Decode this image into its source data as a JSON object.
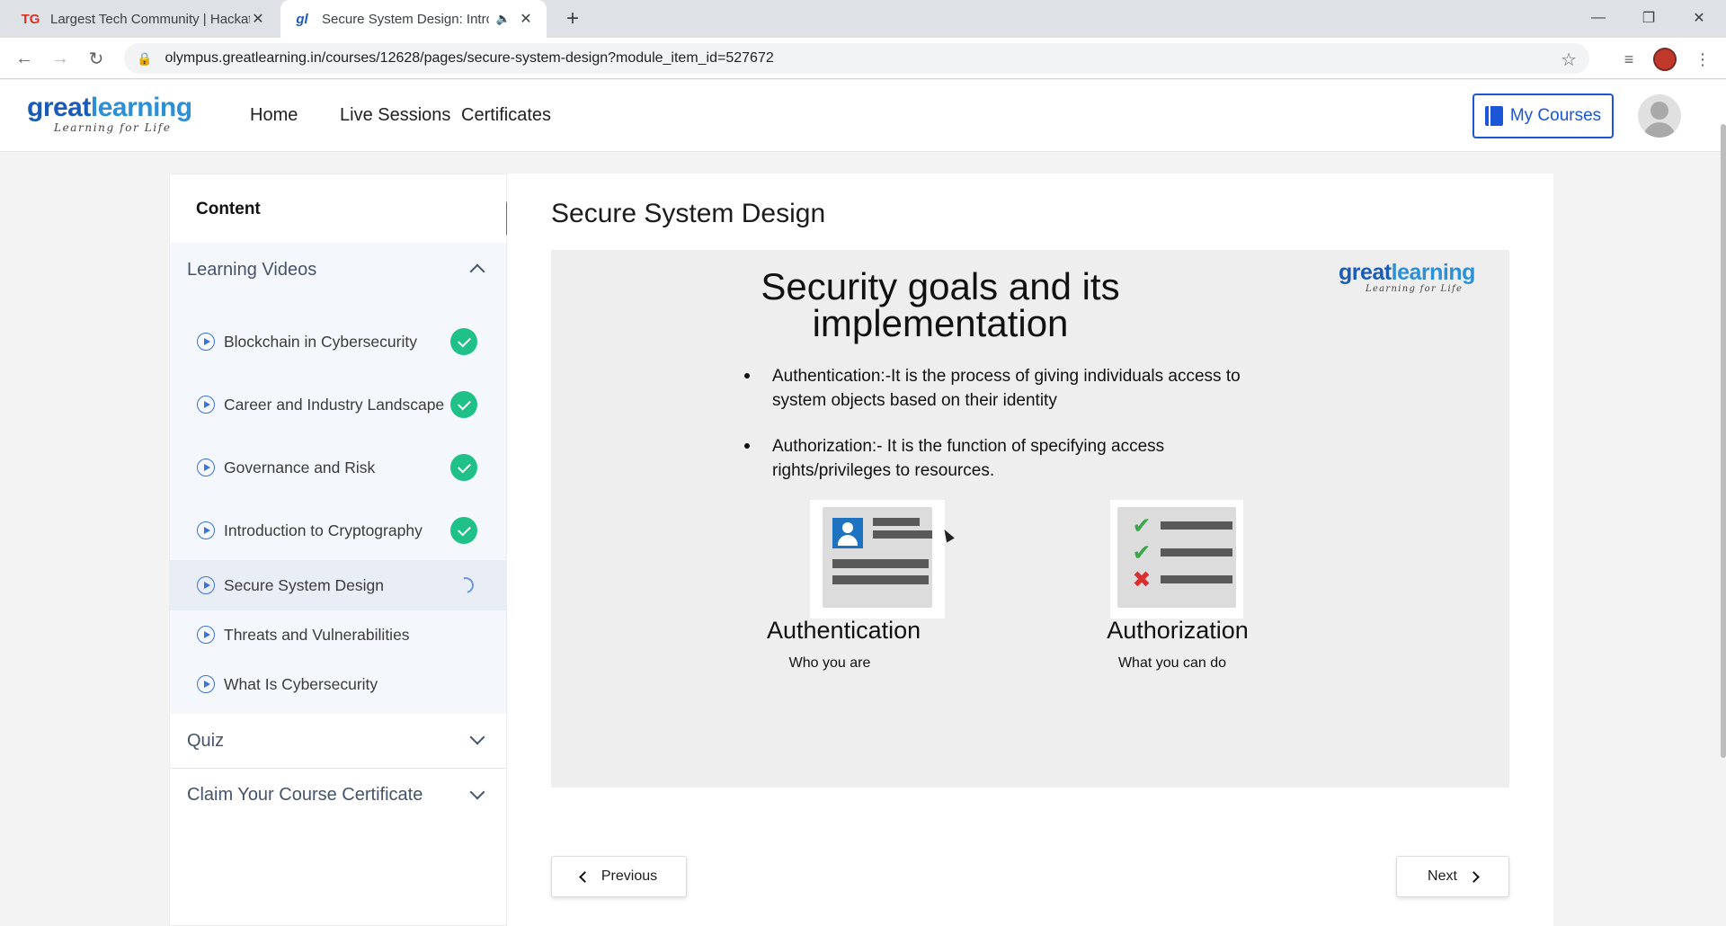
{
  "browser": {
    "tabs": [
      {
        "favicon": "TG",
        "title": "Largest Tech Community | Hackat"
      },
      {
        "favicon": "gl",
        "title": "Secure System Design: Introd"
      }
    ],
    "url": "olympus.greatlearning.in/courses/12628/pages/secure-system-design?module_item_id=527672"
  },
  "header": {
    "logo_main_a": "great",
    "logo_main_b": "learning",
    "logo_tagline": "Learning for Life",
    "nav": [
      "Home",
      "Live Sessions",
      "Certificates"
    ],
    "my_courses": "My Courses"
  },
  "sidebar": {
    "title": "Content",
    "sections": [
      {
        "label": "Learning Videos",
        "expanded": true,
        "items": [
          {
            "label": "Blockchain in Cybersecurity",
            "status": "done"
          },
          {
            "label": "Career and Industry Landscape",
            "status": "done"
          },
          {
            "label": "Governance and Risk",
            "status": "done"
          },
          {
            "label": "Introduction to Cryptography",
            "status": "done"
          },
          {
            "label": "Secure System Design",
            "status": "loading"
          },
          {
            "label": "Threats and Vulnerabilities",
            "status": "none"
          },
          {
            "label": "What Is Cybersecurity",
            "status": "none"
          }
        ]
      },
      {
        "label": "Quiz",
        "expanded": false
      },
      {
        "label": "Claim Your Course Certificate",
        "expanded": false
      }
    ]
  },
  "main": {
    "title": "Secure System Design",
    "slide": {
      "heading": "Security goals and its implementation",
      "bullets": [
        "Authentication:-It is the process of giving individuals access to system objects based on their identity",
        "Authorization:- It is the function of specifying access rights/privileges to resources."
      ],
      "figures": [
        {
          "label": "Authentication",
          "caption": "Who you are"
        },
        {
          "label": "Authorization",
          "caption": "What you can do"
        }
      ]
    },
    "previous_label": "Previous",
    "next_label": "Next"
  },
  "colors": {
    "brand_blue": "#1b5bb8",
    "accent_blue": "#1a56d6",
    "collapse_button": "#4f63e6",
    "done_green": "#1fc188"
  }
}
